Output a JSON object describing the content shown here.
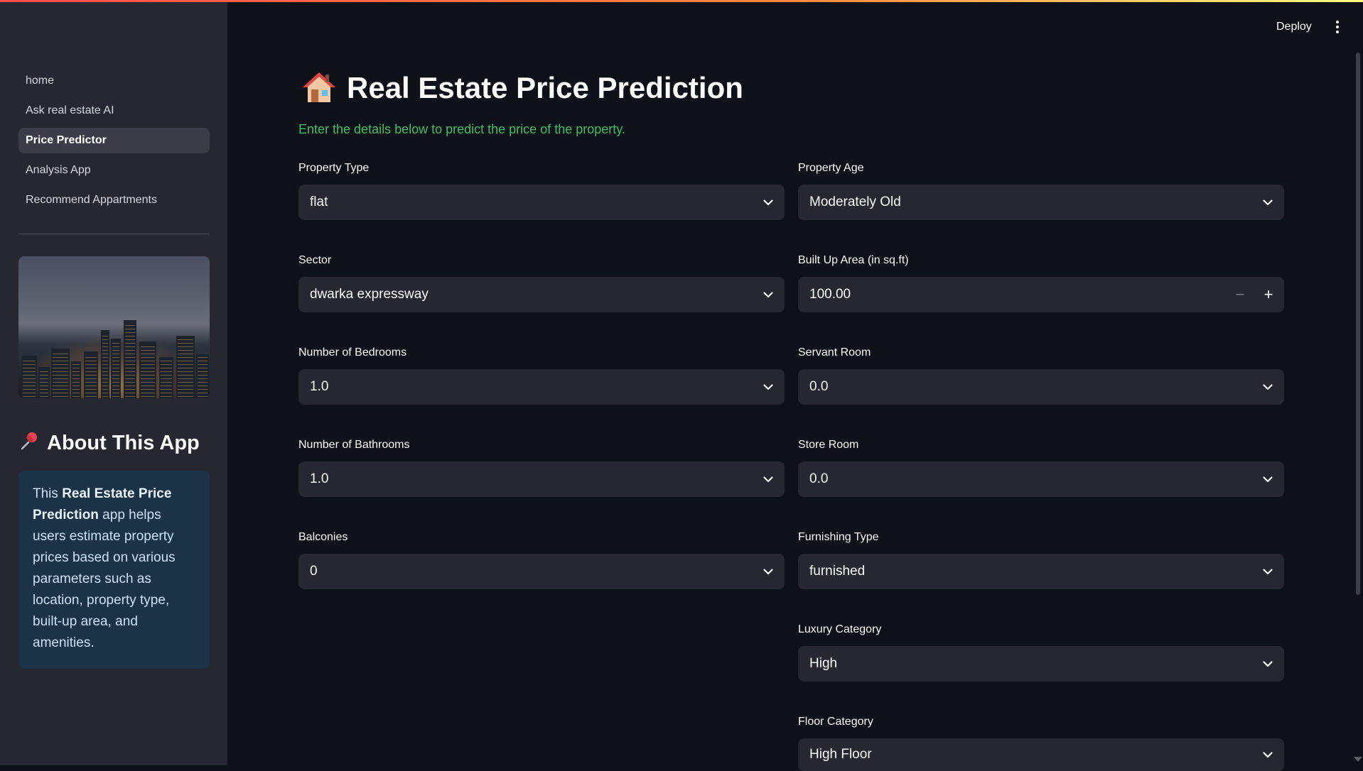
{
  "header": {
    "deploy_label": "Deploy",
    "menu_icon": "kebab-menu-icon"
  },
  "sidebar": {
    "items": [
      {
        "label": "home",
        "active": false
      },
      {
        "label": "Ask real estate AI",
        "active": false
      },
      {
        "label": "Price Predictor",
        "active": true
      },
      {
        "label": "Analysis App",
        "active": false
      },
      {
        "label": "Recommend Appartments",
        "active": false
      }
    ],
    "about": {
      "heading": "About This App",
      "heading_icon": "pushpin-icon",
      "text_before": "This ",
      "text_bold": "Real Estate Price Prediction",
      "text_after": " app helps users estimate property prices based on various parameters such as location, property type, built-up area, and amenities."
    }
  },
  "main": {
    "title_icon": "house-icon",
    "title": "Real Estate Price Prediction",
    "subtitle": "Enter the details below to predict the price of the property.",
    "fields": {
      "property_type": {
        "label": "Property Type",
        "value": "flat"
      },
      "property_age": {
        "label": "Property Age",
        "value": "Moderately Old"
      },
      "sector": {
        "label": "Sector",
        "value": "dwarka expressway"
      },
      "built_up_area": {
        "label": "Built Up Area (in sq.ft)",
        "value": "100.00"
      },
      "bedrooms": {
        "label": "Number of Bedrooms",
        "value": "1.0"
      },
      "servant_room": {
        "label": "Servant Room",
        "value": "0.0"
      },
      "bathrooms": {
        "label": "Number of Bathrooms",
        "value": "1.0"
      },
      "store_room": {
        "label": "Store Room",
        "value": "0.0"
      },
      "balconies": {
        "label": "Balconies",
        "value": "0"
      },
      "furnishing_type": {
        "label": "Furnishing Type",
        "value": "furnished"
      },
      "luxury_category": {
        "label": "Luxury Category",
        "value": "High"
      },
      "floor_category": {
        "label": "Floor Category",
        "value": "High Floor"
      }
    }
  },
  "colors": {
    "accent_green": "#3dbf6a",
    "background": "#0e1117",
    "sidebar": "#262730",
    "about_box": "#1c3246"
  }
}
